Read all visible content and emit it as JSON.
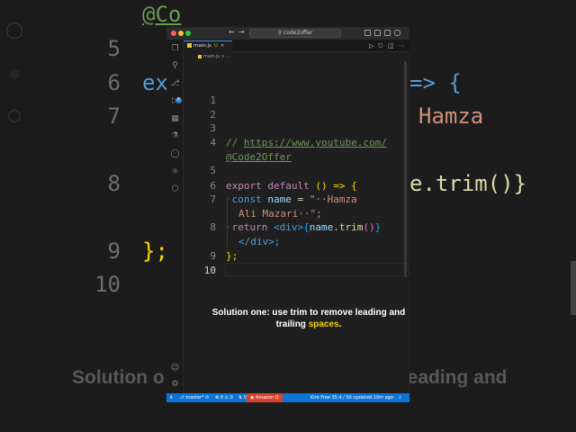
{
  "background": {
    "line_numbers": [
      "5",
      "6",
      "7",
      "8",
      "9",
      "10"
    ],
    "top_fragment": "@Co",
    "line6_left": "ex",
    "line6_right": "=> {",
    "line7_right": "Hamza",
    "line8_right": "e.trim()}",
    "line9": "};",
    "caption_left": "Solution o",
    "caption_right": "eading and"
  },
  "window": {
    "title": "code2offer",
    "tab": {
      "file": "main.js",
      "modified": "U",
      "close": "×"
    },
    "breadcrumb": {
      "file": "main.js",
      "sep": ">",
      "rest": "..."
    }
  },
  "editor": {
    "line_numbers": [
      "1",
      "2",
      "3",
      "4",
      "",
      "5",
      "6",
      "7",
      "",
      "8",
      "",
      "9",
      "10"
    ],
    "comment_prefix": "// ",
    "url_part1": "https://www.youtube.com/",
    "url_part2": "@Code2Offer",
    "export_kw": "export",
    "default_kw": "default",
    "arrow_fn": "() => {",
    "const_kw": "const",
    "var_name": "name",
    "equals": " = ",
    "str_open": "\"",
    "str_part1": "··Hamza",
    "str_part2": "Ali Mazari··",
    "str_close": "\";",
    "return_kw": "return",
    "jsx_open": "<div>",
    "brace_open": "{",
    "expr": "name",
    "method": ".trim",
    "call": "()",
    "brace_close": "}",
    "jsx_close": "</div>;",
    "closing": "};"
  },
  "caption": {
    "line1": "Solution one: use trim to remove leading and",
    "line2_pre": "trailing ",
    "line2_highlight": "spaces",
    "line2_post": "."
  },
  "status_bar": {
    "branch": "master*",
    "problems": "⊗ 0 ⚠ 0",
    "ports": "0",
    "amazon_q": "Amazon Q",
    "kiro": "Kiro Free 35.4 / 50 updated 10m ago"
  },
  "colors": {
    "accent": "#0e75d6",
    "amazon_q": "#d9412e",
    "highlight": "#f0d400"
  }
}
